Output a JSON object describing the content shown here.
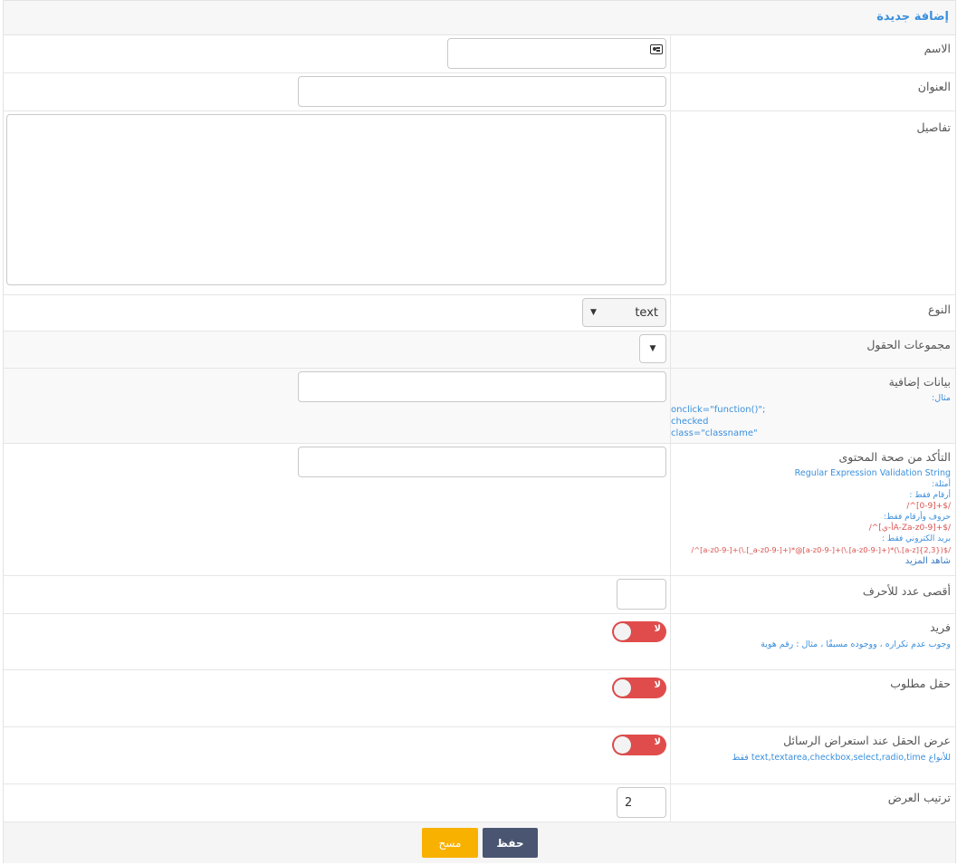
{
  "panel": {
    "title": "إضافة جديدة"
  },
  "fields": {
    "name": {
      "label": "الاسم",
      "value": ""
    },
    "address": {
      "label": "العنوان",
      "value": ""
    },
    "details": {
      "label": "تفاصيل",
      "value": ""
    },
    "type": {
      "label": "النوع",
      "selected": "text"
    },
    "field_groups": {
      "label": "مجموعات الحقول",
      "selected": ""
    },
    "extra_data": {
      "label": "بيانات إضافية",
      "value": "",
      "example_label": "مثال:",
      "examples": [
        "onclick=\"function()\";",
        "checked",
        "class=\"classname\""
      ]
    },
    "validation": {
      "label": "التأكد من صحة المحتوى",
      "value": "",
      "help_title": "Regular Expression Validation String",
      "examples_label": "أمثلة:",
      "numbers_label": "أرقام فقط :",
      "numbers_regex": "/^[0-9]+$/",
      "alnum_label": "حروف وأرقام فقط:",
      "alnum_regex": "/^[أ-يA-Za-z0-9]+$/",
      "email_label": "بريد الكتروني فقط :",
      "email_regex": "/^[a-z0-9-]+(\\.[_a-z0-9-]+)*@[a-z0-9-]+(\\.[a-z0-9-]+)*(\\.[a-z]{2,3})$/",
      "more_link": "شاهد المزيد"
    },
    "max_chars": {
      "label": "أقصى عدد للأحرف",
      "value": ""
    },
    "unique": {
      "label": "فريد",
      "toggle_text": "لا",
      "help": "وجوب عدم تكراره ، ووجوده مسبقًا ، مثال : رقم هوية"
    },
    "required": {
      "label": "حقل مطلوب",
      "toggle_text": "لا"
    },
    "show_in_messages": {
      "label": "عرض الحقل عند استعراض الرسائل",
      "toggle_text": "لا",
      "help_prefix": "للأنواع",
      "help_types": "text,textarea,checkbox,select,radio,time",
      "help_suffix": "فقط"
    },
    "display_order": {
      "label": "ترتيب العرض",
      "value": "2"
    }
  },
  "buttons": {
    "save": "حفظ",
    "clear": "مسح"
  }
}
